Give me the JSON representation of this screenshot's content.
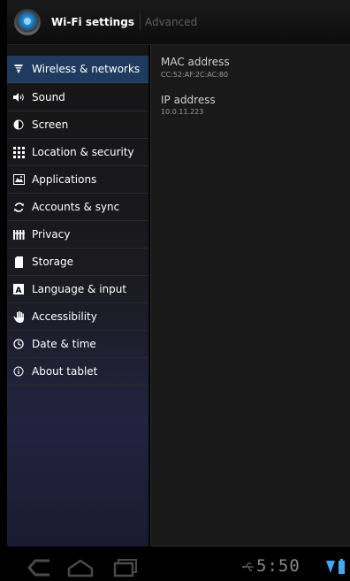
{
  "action_bar": {
    "title": "Wi-Fi settings",
    "tab": "Advanced"
  },
  "menu": {
    "items": [
      {
        "label": "Wireless & networks",
        "icon": "wifi-icon",
        "selected": true
      },
      {
        "label": "Sound",
        "icon": "speaker-icon",
        "selected": false
      },
      {
        "label": "Screen",
        "icon": "brightness-icon",
        "selected": false
      },
      {
        "label": "Location & security",
        "icon": "location-grid-icon",
        "selected": false
      },
      {
        "label": "Applications",
        "icon": "applications-icon",
        "selected": false
      },
      {
        "label": "Accounts & sync",
        "icon": "sync-icon",
        "selected": false
      },
      {
        "label": "Privacy",
        "icon": "privacy-icon",
        "selected": false
      },
      {
        "label": "Storage",
        "icon": "storage-icon",
        "selected": false
      },
      {
        "label": "Language & input",
        "icon": "keyboard-a-icon",
        "selected": false
      },
      {
        "label": "Accessibility",
        "icon": "hand-icon",
        "selected": false
      },
      {
        "label": "Date & time",
        "icon": "clock-icon",
        "selected": false
      },
      {
        "label": "About tablet",
        "icon": "info-icon",
        "selected": false
      }
    ]
  },
  "details": {
    "mac_label": "MAC address",
    "mac_value": "CC:52:AF:2C:AC:80",
    "ip_label": "IP address",
    "ip_value": "10.0.11.223"
  },
  "status_bar": {
    "time": "5:50"
  },
  "colors": {
    "selected_row": "#1f3a5e",
    "status_icon_blue": "#3fa9f5"
  }
}
